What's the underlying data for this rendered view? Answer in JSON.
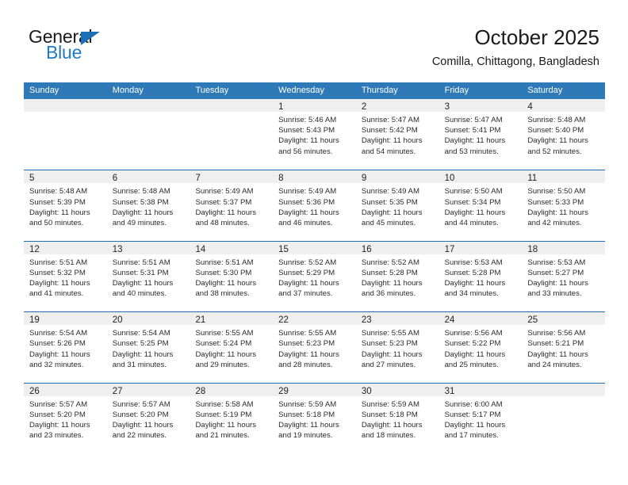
{
  "brand": {
    "word1": "General",
    "word2": "Blue",
    "logo_icon": "triangle-logo-icon",
    "accent_color": "#1a6fb5",
    "blue_text_color": "#1f7ac0"
  },
  "header": {
    "title": "October 2025",
    "subtitle": "Comilla, Chittagong, Bangladesh"
  },
  "calendar": {
    "header_bg": "#2e7ab8",
    "row_divider_color": "#1f6db2",
    "datestrip_bg": "#efefef",
    "weekdays": [
      "Sunday",
      "Monday",
      "Tuesday",
      "Wednesday",
      "Thursday",
      "Friday",
      "Saturday"
    ],
    "weeks": [
      [
        {
          "day": "",
          "blank": true
        },
        {
          "day": "",
          "blank": true
        },
        {
          "day": "",
          "blank": true
        },
        {
          "day": "1",
          "sunrise": "Sunrise: 5:46 AM",
          "sunset": "Sunset: 5:43 PM",
          "daylight1": "Daylight: 11 hours",
          "daylight2": "and 56 minutes."
        },
        {
          "day": "2",
          "sunrise": "Sunrise: 5:47 AM",
          "sunset": "Sunset: 5:42 PM",
          "daylight1": "Daylight: 11 hours",
          "daylight2": "and 54 minutes."
        },
        {
          "day": "3",
          "sunrise": "Sunrise: 5:47 AM",
          "sunset": "Sunset: 5:41 PM",
          "daylight1": "Daylight: 11 hours",
          "daylight2": "and 53 minutes."
        },
        {
          "day": "4",
          "sunrise": "Sunrise: 5:48 AM",
          "sunset": "Sunset: 5:40 PM",
          "daylight1": "Daylight: 11 hours",
          "daylight2": "and 52 minutes."
        }
      ],
      [
        {
          "day": "5",
          "sunrise": "Sunrise: 5:48 AM",
          "sunset": "Sunset: 5:39 PM",
          "daylight1": "Daylight: 11 hours",
          "daylight2": "and 50 minutes."
        },
        {
          "day": "6",
          "sunrise": "Sunrise: 5:48 AM",
          "sunset": "Sunset: 5:38 PM",
          "daylight1": "Daylight: 11 hours",
          "daylight2": "and 49 minutes."
        },
        {
          "day": "7",
          "sunrise": "Sunrise: 5:49 AM",
          "sunset": "Sunset: 5:37 PM",
          "daylight1": "Daylight: 11 hours",
          "daylight2": "and 48 minutes."
        },
        {
          "day": "8",
          "sunrise": "Sunrise: 5:49 AM",
          "sunset": "Sunset: 5:36 PM",
          "daylight1": "Daylight: 11 hours",
          "daylight2": "and 46 minutes."
        },
        {
          "day": "9",
          "sunrise": "Sunrise: 5:49 AM",
          "sunset": "Sunset: 5:35 PM",
          "daylight1": "Daylight: 11 hours",
          "daylight2": "and 45 minutes."
        },
        {
          "day": "10",
          "sunrise": "Sunrise: 5:50 AM",
          "sunset": "Sunset: 5:34 PM",
          "daylight1": "Daylight: 11 hours",
          "daylight2": "and 44 minutes."
        },
        {
          "day": "11",
          "sunrise": "Sunrise: 5:50 AM",
          "sunset": "Sunset: 5:33 PM",
          "daylight1": "Daylight: 11 hours",
          "daylight2": "and 42 minutes."
        }
      ],
      [
        {
          "day": "12",
          "sunrise": "Sunrise: 5:51 AM",
          "sunset": "Sunset: 5:32 PM",
          "daylight1": "Daylight: 11 hours",
          "daylight2": "and 41 minutes."
        },
        {
          "day": "13",
          "sunrise": "Sunrise: 5:51 AM",
          "sunset": "Sunset: 5:31 PM",
          "daylight1": "Daylight: 11 hours",
          "daylight2": "and 40 minutes."
        },
        {
          "day": "14",
          "sunrise": "Sunrise: 5:51 AM",
          "sunset": "Sunset: 5:30 PM",
          "daylight1": "Daylight: 11 hours",
          "daylight2": "and 38 minutes."
        },
        {
          "day": "15",
          "sunrise": "Sunrise: 5:52 AM",
          "sunset": "Sunset: 5:29 PM",
          "daylight1": "Daylight: 11 hours",
          "daylight2": "and 37 minutes."
        },
        {
          "day": "16",
          "sunrise": "Sunrise: 5:52 AM",
          "sunset": "Sunset: 5:28 PM",
          "daylight1": "Daylight: 11 hours",
          "daylight2": "and 36 minutes."
        },
        {
          "day": "17",
          "sunrise": "Sunrise: 5:53 AM",
          "sunset": "Sunset: 5:28 PM",
          "daylight1": "Daylight: 11 hours",
          "daylight2": "and 34 minutes."
        },
        {
          "day": "18",
          "sunrise": "Sunrise: 5:53 AM",
          "sunset": "Sunset: 5:27 PM",
          "daylight1": "Daylight: 11 hours",
          "daylight2": "and 33 minutes."
        }
      ],
      [
        {
          "day": "19",
          "sunrise": "Sunrise: 5:54 AM",
          "sunset": "Sunset: 5:26 PM",
          "daylight1": "Daylight: 11 hours",
          "daylight2": "and 32 minutes."
        },
        {
          "day": "20",
          "sunrise": "Sunrise: 5:54 AM",
          "sunset": "Sunset: 5:25 PM",
          "daylight1": "Daylight: 11 hours",
          "daylight2": "and 31 minutes."
        },
        {
          "day": "21",
          "sunrise": "Sunrise: 5:55 AM",
          "sunset": "Sunset: 5:24 PM",
          "daylight1": "Daylight: 11 hours",
          "daylight2": "and 29 minutes."
        },
        {
          "day": "22",
          "sunrise": "Sunrise: 5:55 AM",
          "sunset": "Sunset: 5:23 PM",
          "daylight1": "Daylight: 11 hours",
          "daylight2": "and 28 minutes."
        },
        {
          "day": "23",
          "sunrise": "Sunrise: 5:55 AM",
          "sunset": "Sunset: 5:23 PM",
          "daylight1": "Daylight: 11 hours",
          "daylight2": "and 27 minutes."
        },
        {
          "day": "24",
          "sunrise": "Sunrise: 5:56 AM",
          "sunset": "Sunset: 5:22 PM",
          "daylight1": "Daylight: 11 hours",
          "daylight2": "and 25 minutes."
        },
        {
          "day": "25",
          "sunrise": "Sunrise: 5:56 AM",
          "sunset": "Sunset: 5:21 PM",
          "daylight1": "Daylight: 11 hours",
          "daylight2": "and 24 minutes."
        }
      ],
      [
        {
          "day": "26",
          "sunrise": "Sunrise: 5:57 AM",
          "sunset": "Sunset: 5:20 PM",
          "daylight1": "Daylight: 11 hours",
          "daylight2": "and 23 minutes."
        },
        {
          "day": "27",
          "sunrise": "Sunrise: 5:57 AM",
          "sunset": "Sunset: 5:20 PM",
          "daylight1": "Daylight: 11 hours",
          "daylight2": "and 22 minutes."
        },
        {
          "day": "28",
          "sunrise": "Sunrise: 5:58 AM",
          "sunset": "Sunset: 5:19 PM",
          "daylight1": "Daylight: 11 hours",
          "daylight2": "and 21 minutes."
        },
        {
          "day": "29",
          "sunrise": "Sunrise: 5:59 AM",
          "sunset": "Sunset: 5:18 PM",
          "daylight1": "Daylight: 11 hours",
          "daylight2": "and 19 minutes."
        },
        {
          "day": "30",
          "sunrise": "Sunrise: 5:59 AM",
          "sunset": "Sunset: 5:18 PM",
          "daylight1": "Daylight: 11 hours",
          "daylight2": "and 18 minutes."
        },
        {
          "day": "31",
          "sunrise": "Sunrise: 6:00 AM",
          "sunset": "Sunset: 5:17 PM",
          "daylight1": "Daylight: 11 hours",
          "daylight2": "and 17 minutes."
        },
        {
          "day": "",
          "blank": true
        }
      ]
    ]
  }
}
